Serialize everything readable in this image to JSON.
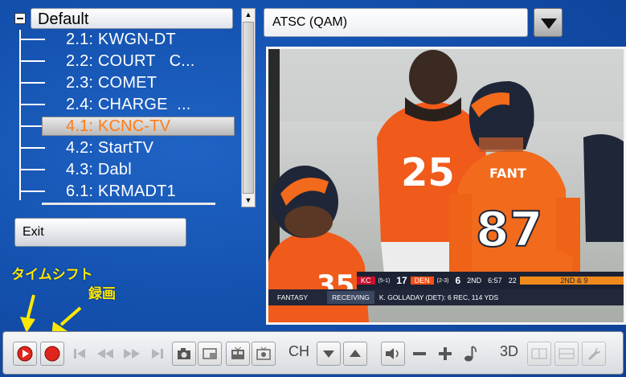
{
  "channel_tree": {
    "group_label": "Default",
    "channels": [
      {
        "label": "2.1: KWGN-DT",
        "selected": false
      },
      {
        "label": "2.2: COURT   C...",
        "selected": false
      },
      {
        "label": "2.3: COMET",
        "selected": false
      },
      {
        "label": "2.4: CHARGE  ...",
        "selected": false
      },
      {
        "label": "4.1: KCNC-TV",
        "selected": true
      },
      {
        "label": "4.2: StartTV",
        "selected": false
      },
      {
        "label": "4.3: Dabl",
        "selected": false
      },
      {
        "label": "6.1: KRMADT1",
        "selected": false
      }
    ]
  },
  "exit_label": "Exit",
  "source": {
    "value": "ATSC (QAM)"
  },
  "video": {
    "score_bug": {
      "team1": "KC",
      "team1_record": "(5-1)",
      "score1": "17",
      "team2": "DEN",
      "team2_record": "(2-3)",
      "score2": "6",
      "quarter": "2ND",
      "clock": "6:57",
      "playclock": "22",
      "down": "2ND & 9"
    },
    "ticker": {
      "tag": "FANTASY",
      "category": "RECEIVING",
      "text": "K. GOLLADAY (DET): 6 REC, 114 YDS"
    },
    "jersey_names": [
      "FANT"
    ],
    "jersey_numbers": [
      "25",
      "87",
      "35"
    ]
  },
  "annotations": {
    "timeshift": "タイムシフト",
    "record": "録画"
  },
  "toolbar": {
    "ch_label": "CH",
    "mode_3d_label": "3D",
    "colors": {
      "play": "#e0261c",
      "record": "#e0261c",
      "accent": "#ff7b14"
    }
  }
}
